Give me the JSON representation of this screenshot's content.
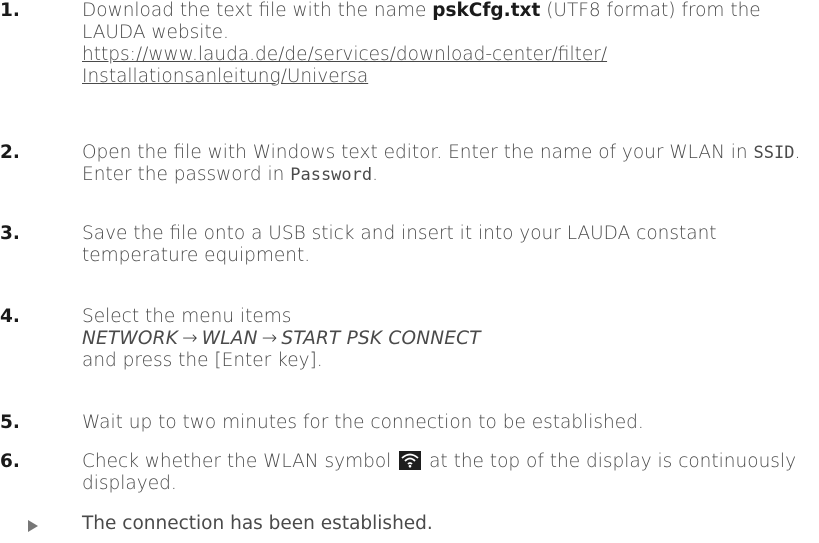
{
  "steps": [
    {
      "number": "1.",
      "text_before": "Download the text file with the name ",
      "filename": "pskCfg.txt",
      "text_after": " (UTF8 format) from the LAUDA website.",
      "link_line1": "https://www.lauda.de/de/services/download-center/filter/",
      "link_line2": "Installationsanleitung/Universa"
    },
    {
      "number": "2.",
      "text_a": "Open the file with Windows text editor. Enter the name of your WLAN in ",
      "ssid": "SSID",
      "text_b": ". Enter the password in ",
      "password": "Password",
      "text_c": "."
    },
    {
      "number": "3.",
      "text": "Save the file onto a USB stick and insert it into your LAUDA constant temperature equipment."
    },
    {
      "number": "4.",
      "line1": "Select the menu items",
      "menu_1": "NETWORK",
      "arrow_1": "→",
      "menu_2": "WLAN",
      "arrow_2": "→",
      "menu_3": "START PSK CONNECT",
      "line3": "and press the [Enter key]."
    },
    {
      "number": "5.",
      "text": "Wait up to two minutes for the connection to be established."
    },
    {
      "number": "6.",
      "text_before": "Check whether the WLAN symbol ",
      "icon": "wifi-icon",
      "text_after": " at the top of the display is continuously displayed."
    }
  ],
  "result": {
    "icon": "result-triangle-icon",
    "text": "The connection has been established."
  }
}
